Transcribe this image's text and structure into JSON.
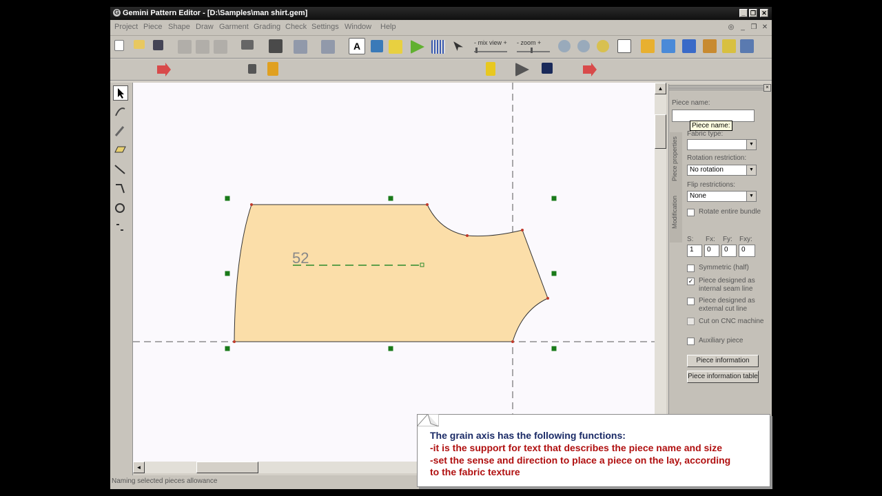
{
  "window": {
    "title": "Gemini Pattern Editor - [D:\\Samples\\man shirt.gem]",
    "min": "_",
    "max": "❐",
    "close": "✕"
  },
  "menu": {
    "items": [
      "Project",
      "Piece",
      "Shape",
      "Draw",
      "Garment",
      "Grading",
      "Check",
      "Settings",
      "Window",
      "Help"
    ]
  },
  "toolbar": {
    "mix_view_label": "- mix view +",
    "zoom_label": "- zoom +"
  },
  "canvas": {
    "piece_label": "52",
    "piece_fill": "#fbdea9",
    "handle_color": "#1a7a1a"
  },
  "panel": {
    "piece_name_label": "Piece name:",
    "piece_name_value": "",
    "tooltip": "Piece name:",
    "tabs": [
      "Piece properties",
      "Modification"
    ],
    "fabric_type_label": "Fabric type:",
    "fabric_type_value": "",
    "rotation_label": "Rotation restriction:",
    "rotation_value": "No rotation",
    "flip_label": "Flip restrictions:",
    "flip_value": "None",
    "rotate_bundle_label": "Rotate entire bundle",
    "s_label": "S:",
    "fx_label": "Fx:",
    "fy_label": "Fy:",
    "fxy_label": "Fxy:",
    "s_value": "1",
    "fx_value": "0",
    "fy_value": "0",
    "fxy_value": "0",
    "symmetric_label": "Symmetric (half)",
    "internal_seam_label": "Piece designed as internal seam line",
    "internal_seam_checked": "✓",
    "external_cut_label": "Piece designed as external cut line",
    "cnc_label": "Cut on CNC machine",
    "auxiliary_label": "Auxiliary piece",
    "piece_info_button": "Piece information",
    "piece_info_table_button": "Piece information table"
  },
  "status": {
    "text": "Naming selected pieces allowance"
  },
  "callout": {
    "title": "The grain axis has the following functions:",
    "line1": "-it is the support for text that describes the piece name and size",
    "line2": "-set the sense and direction to place a piece on the lay, according",
    "line3": "to the fabric texture"
  }
}
